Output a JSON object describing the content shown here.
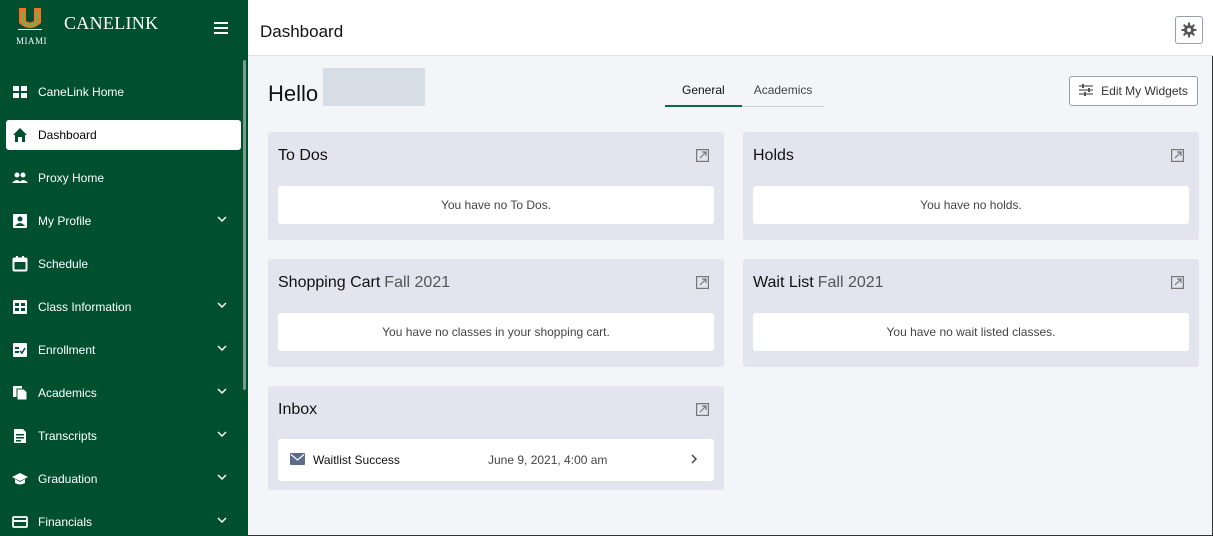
{
  "brand": {
    "logo_text": "MIAMI",
    "title": "CANELINK"
  },
  "sidebar": {
    "items": [
      {
        "label": "CaneLink Home",
        "icon": "home-grid-icon",
        "expandable": false
      },
      {
        "label": "Dashboard",
        "icon": "house-icon",
        "expandable": false,
        "active": true
      },
      {
        "label": "Proxy Home",
        "icon": "people-icon",
        "expandable": false
      },
      {
        "label": "My Profile",
        "icon": "profile-card-icon",
        "expandable": true
      },
      {
        "label": "Schedule",
        "icon": "calendar-icon",
        "expandable": false
      },
      {
        "label": "Class Information",
        "icon": "class-info-icon",
        "expandable": true
      },
      {
        "label": "Enrollment",
        "icon": "enrollment-icon",
        "expandable": true
      },
      {
        "label": "Academics",
        "icon": "documents-icon",
        "expandable": true
      },
      {
        "label": "Transcripts",
        "icon": "transcript-icon",
        "expandable": true
      },
      {
        "label": "Graduation",
        "icon": "graduation-cap-icon",
        "expandable": true
      },
      {
        "label": "Financials",
        "icon": "credit-card-icon",
        "expandable": true
      }
    ]
  },
  "header": {
    "title": "Dashboard"
  },
  "main": {
    "greeting": "Hello",
    "tabs": [
      {
        "label": "General",
        "active": true
      },
      {
        "label": "Academics",
        "active": false
      }
    ],
    "edit_widgets_label": "Edit My Widgets",
    "cards": {
      "todos": {
        "title": "To Dos",
        "message": "You have no To Dos."
      },
      "holds": {
        "title": "Holds",
        "message": "You have no holds."
      },
      "cart": {
        "title": "Shopping Cart",
        "term": "Fall 2021",
        "message": "You have no classes in your shopping cart."
      },
      "waitlist": {
        "title": "Wait List",
        "term": "Fall 2021",
        "message": "You have no wait listed classes."
      },
      "inbox": {
        "title": "Inbox",
        "messages": [
          {
            "subject": "Waitlist Success",
            "date": "June 9, 2021, 4:00 am"
          }
        ]
      }
    }
  },
  "colors": {
    "sidebar_bg": "#005030",
    "accent": "#0b6b47",
    "logo_orange": "#f47321",
    "card_bg": "#e2e5ed"
  }
}
